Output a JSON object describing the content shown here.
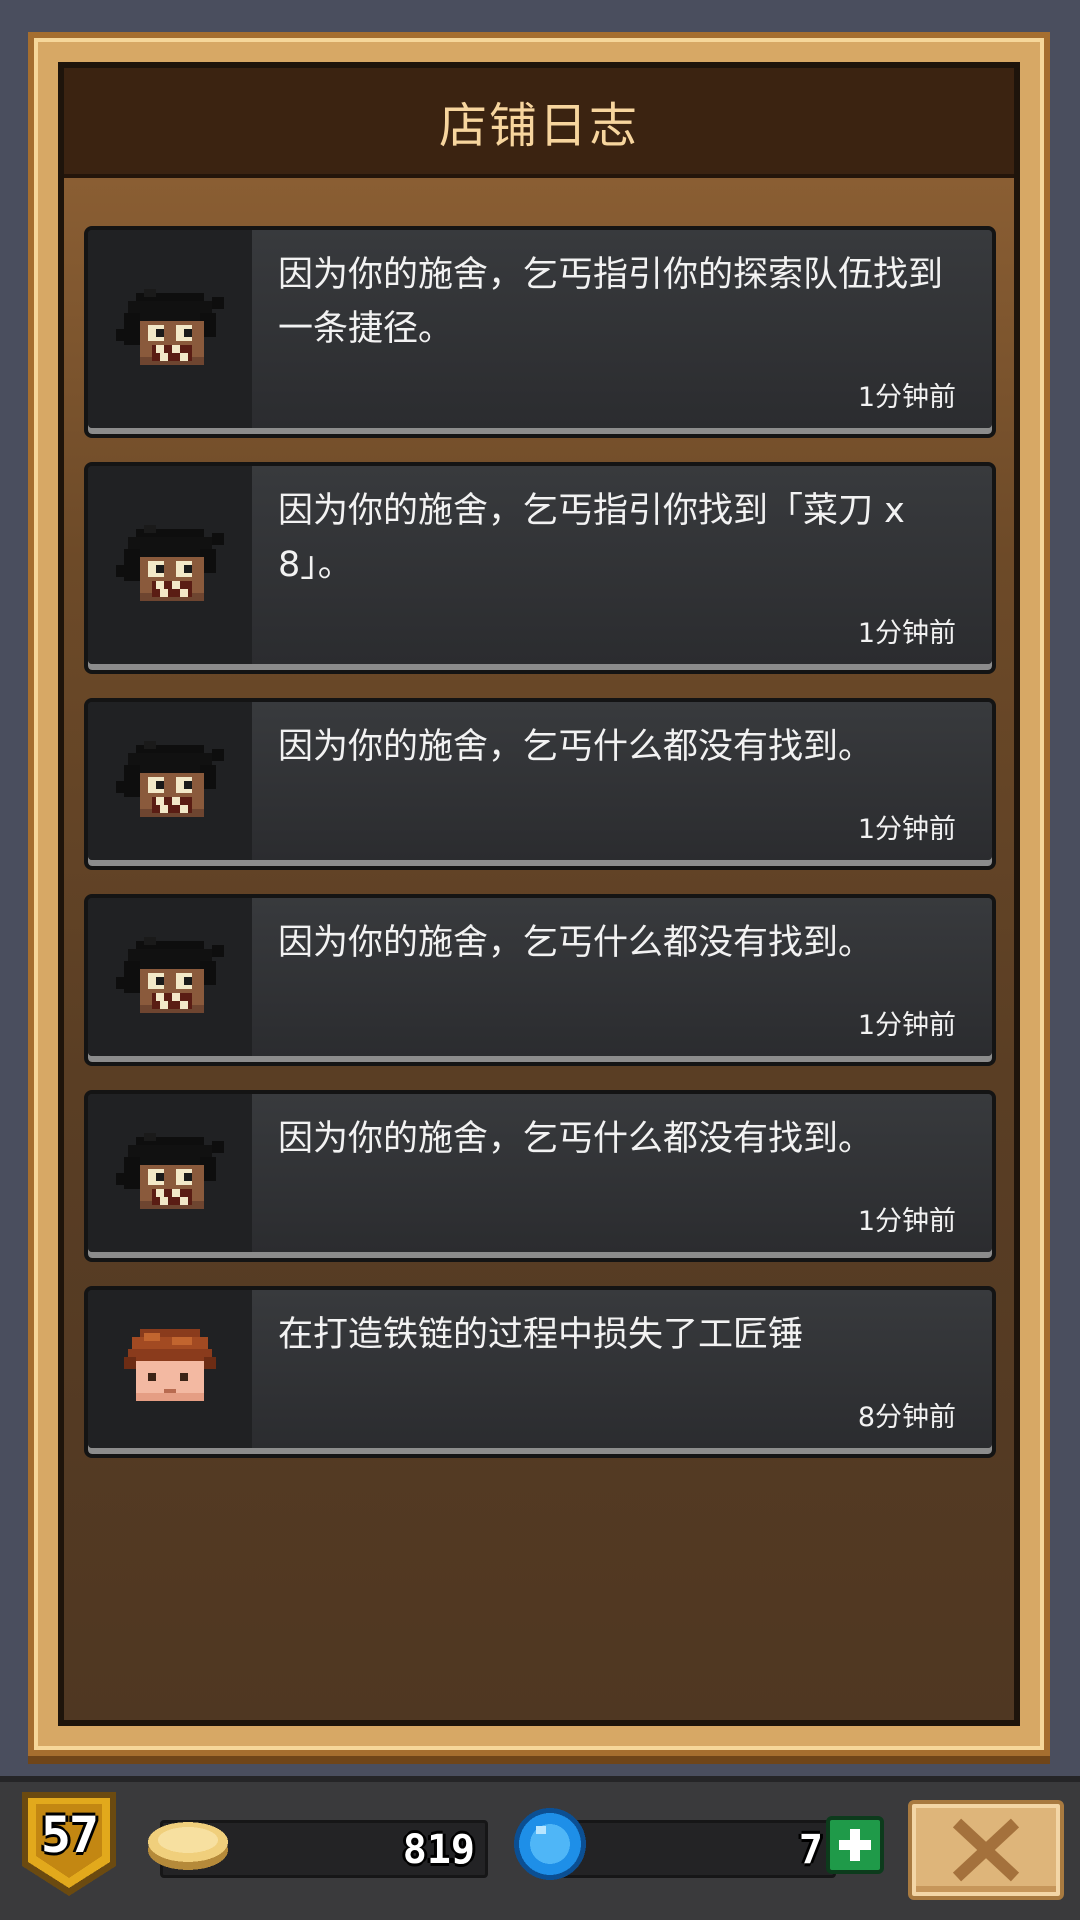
{
  "panel": {
    "title": "店铺日志"
  },
  "log": [
    {
      "text": "因为你的施舍，乞丐指引你的探索队伍找到一条捷径。",
      "time": "1分钟前",
      "portrait": "beggar-portrait"
    },
    {
      "text": "因为你的施舍，乞丐指引你找到「菜刀 x 8」。",
      "time": "1分钟前",
      "portrait": "beggar-portrait"
    },
    {
      "text": "因为你的施舍，乞丐什么都没有找到。",
      "time": "1分钟前",
      "portrait": "beggar-portrait"
    },
    {
      "text": "因为你的施舍，乞丐什么都没有找到。",
      "time": "1分钟前",
      "portrait": "beggar-portrait"
    },
    {
      "text": "因为你的施舍，乞丐什么都没有找到。",
      "time": "1分钟前",
      "portrait": "beggar-portrait"
    },
    {
      "text": "在打造铁链的过程中损失了工匠锤",
      "time": "8分钟前",
      "portrait": "craftsman-portrait"
    }
  ],
  "bottom_bar": {
    "level": "57",
    "gold": "819",
    "gems": "7",
    "icons": {
      "level": "level-badge-icon",
      "gold": "gold-coin-icon",
      "gems": "blue-gem-icon",
      "add": "plus-icon",
      "close": "close-x-icon"
    }
  },
  "colors": {
    "title": "#f7d59e",
    "panel_frame": "#d7a865",
    "add_button": "#1f9a49",
    "gem": "#1e8fe8",
    "gold": "#f0cf7c"
  }
}
